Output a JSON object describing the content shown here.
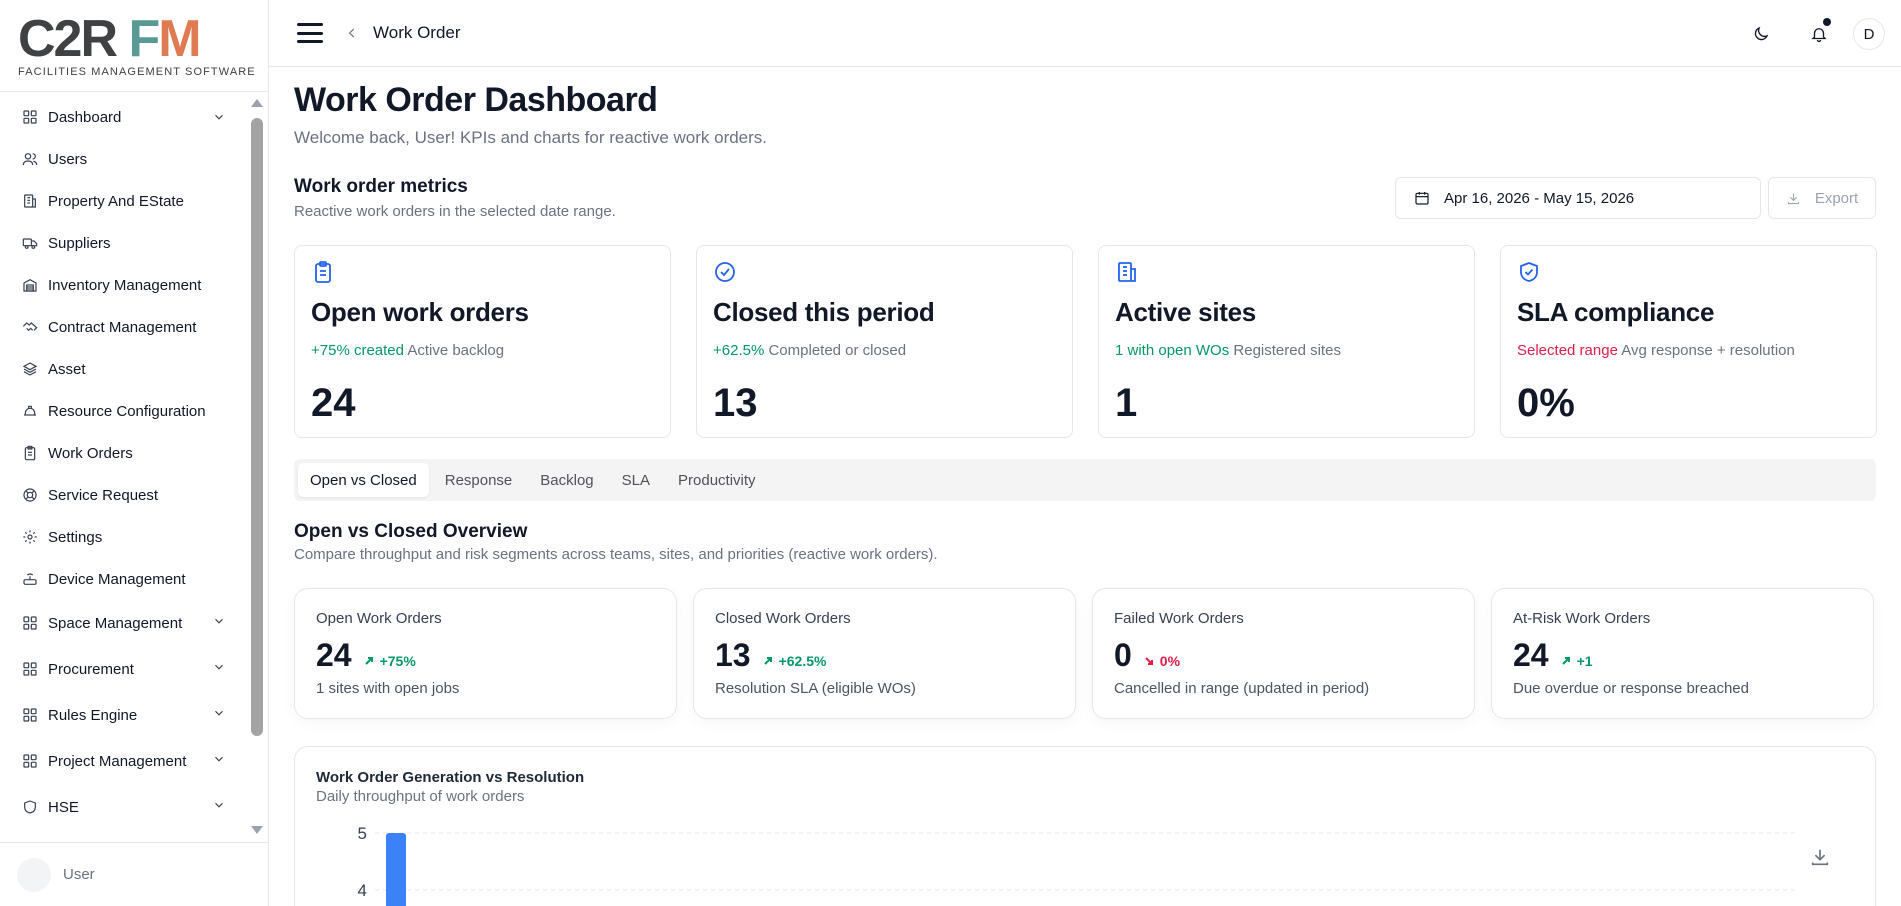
{
  "logo": {
    "c2r": "C2R",
    "fm_f": "F",
    "fm_m": "M",
    "tagline": "FACILITIES MANAGEMENT SOFTWARE"
  },
  "sidebar": {
    "items": [
      {
        "label": "Dashboard",
        "icon": "dashboard-icon",
        "expandable": true
      },
      {
        "label": "Users",
        "icon": "users-icon",
        "expandable": false
      },
      {
        "label": "Property And EState",
        "icon": "building-icon",
        "expandable": false
      },
      {
        "label": "Suppliers",
        "icon": "truck-icon",
        "expandable": false
      },
      {
        "label": "Inventory Management",
        "icon": "warehouse-icon",
        "expandable": false
      },
      {
        "label": "Contract Management",
        "icon": "handshake-icon",
        "expandable": false
      },
      {
        "label": "Asset",
        "icon": "layers-icon",
        "expandable": false
      },
      {
        "label": "Resource Configuration",
        "icon": "hardhat-icon",
        "expandable": false
      },
      {
        "label": "Work Orders",
        "icon": "clipboard-icon",
        "expandable": false
      },
      {
        "label": "Service Request",
        "icon": "lifebuoy-icon",
        "expandable": false
      },
      {
        "label": "Settings",
        "icon": "gear-icon",
        "expandable": false
      },
      {
        "label": "Device Management",
        "icon": "router-icon",
        "expandable": false
      },
      {
        "label": "Space Management",
        "icon": "dashboard-icon",
        "expandable": true
      },
      {
        "label": "Procurement",
        "icon": "dashboard-icon",
        "expandable": true
      },
      {
        "label": "Rules Engine",
        "icon": "dashboard-icon",
        "expandable": true
      },
      {
        "label": "Project Management",
        "icon": "dashboard-icon",
        "expandable": true
      },
      {
        "label": "HSE",
        "icon": "shield-icon",
        "expandable": true
      }
    ],
    "user_name": "User"
  },
  "topbar": {
    "breadcrumb": "Work Order",
    "user_initial": "D"
  },
  "header": {
    "title": "Work Order Dashboard",
    "subtitle": "Welcome back, User! KPIs and charts for reactive work orders."
  },
  "metrics": {
    "title": "Work order metrics",
    "subtitle": "Reactive work orders in the selected date range.",
    "date_range": "Apr 16, 2026 - May 15, 2026",
    "export_label": "Export"
  },
  "kpis": [
    {
      "title": "Open work orders",
      "highlight": "+75% created",
      "highlight_tone": "pos",
      "note": "Active backlog",
      "value": "24",
      "icon": "clipboard-icon"
    },
    {
      "title": "Closed this period",
      "highlight": "+62.5%",
      "highlight_tone": "pos",
      "note": "Completed or closed",
      "value": "13",
      "icon": "check-circle-icon"
    },
    {
      "title": "Active sites",
      "highlight": "1 with open WOs",
      "highlight_tone": "pos",
      "note": "Registered sites",
      "value": "1",
      "icon": "building-icon"
    },
    {
      "title": "SLA compliance",
      "highlight": "Selected range",
      "highlight_tone": "neg",
      "note": "Avg response + resolution",
      "value": "0%",
      "icon": "shield-check-icon"
    }
  ],
  "tabs": [
    {
      "label": "Open vs Closed",
      "active": true
    },
    {
      "label": "Response",
      "active": false
    },
    {
      "label": "Backlog",
      "active": false
    },
    {
      "label": "SLA",
      "active": false
    },
    {
      "label": "Productivity",
      "active": false
    }
  ],
  "overview": {
    "title": "Open vs Closed Overview",
    "subtitle": "Compare throughput and risk segments across teams, sites, and priorities (reactive work orders)."
  },
  "stats": [
    {
      "title": "Open Work Orders",
      "value": "24",
      "delta": "+75%",
      "tone": "pos",
      "footer": "1 sites with open jobs"
    },
    {
      "title": "Closed Work Orders",
      "value": "13",
      "delta": "+62.5%",
      "tone": "pos",
      "footer": "Resolution SLA (eligible WOs)"
    },
    {
      "title": "Failed Work Orders",
      "value": "0",
      "delta": "0%",
      "tone": "neg",
      "footer": "Cancelled in range (updated in period)"
    },
    {
      "title": "At-Risk Work Orders",
      "value": "24",
      "delta": "+1",
      "tone": "pos",
      "footer": "Due overdue or response breached"
    }
  ],
  "chart": {
    "title": "Work Order Generation vs Resolution",
    "subtitle": "Daily throughput of work orders"
  },
  "chart_data": {
    "type": "bar",
    "title": "Work Order Generation vs Resolution",
    "y_ticks": [
      "5",
      "4"
    ],
    "visible_y_range": [
      4,
      5
    ],
    "series": [
      {
        "values": [
          5
        ],
        "color": "#3b82f6"
      }
    ],
    "grid": true
  }
}
